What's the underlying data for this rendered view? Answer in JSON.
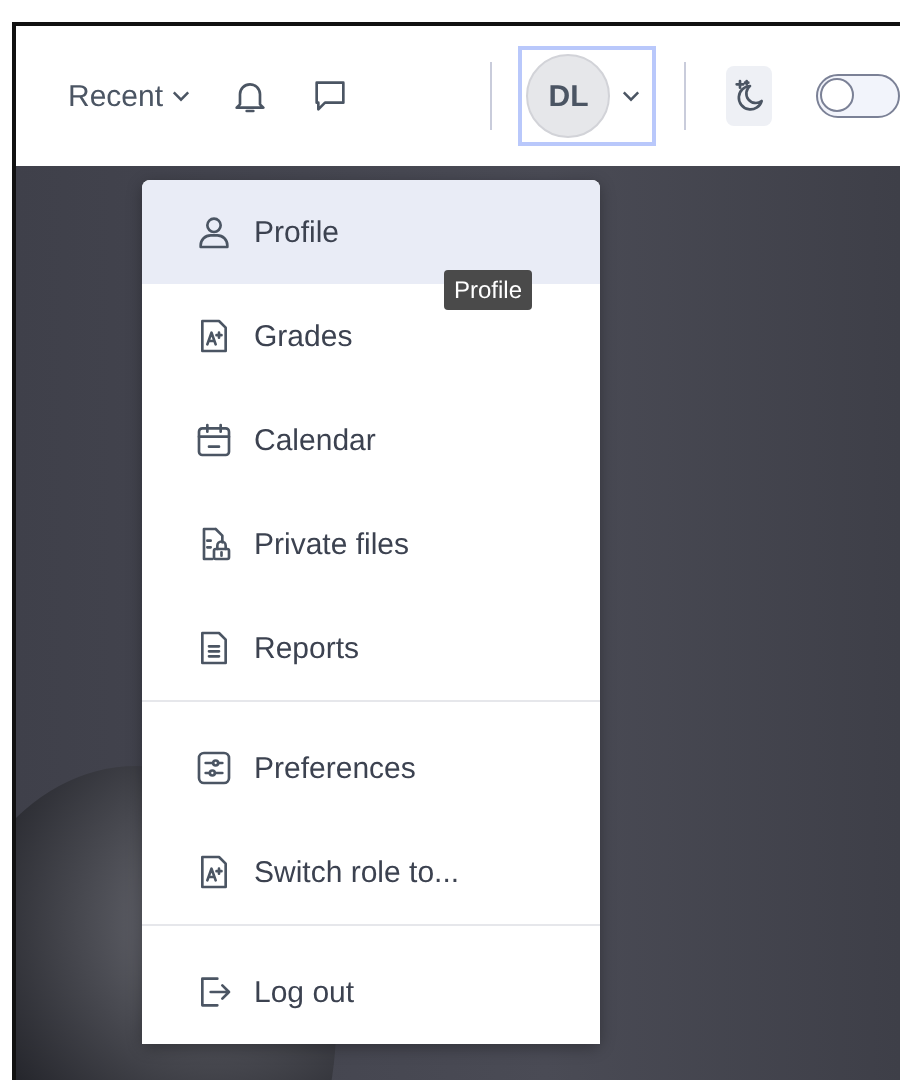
{
  "header": {
    "recent": {
      "label": "Recent"
    },
    "avatar": {
      "initials": "DL"
    },
    "dark_mode_toggle": {
      "on": false
    }
  },
  "user_menu": {
    "groups": [
      [
        {
          "label": "Profile",
          "kind": "person",
          "selected": true
        },
        {
          "label": "Grades",
          "kind": "grade",
          "selected": false
        },
        {
          "label": "Calendar",
          "kind": "calendar",
          "selected": false
        },
        {
          "label": "Private files",
          "kind": "files",
          "selected": false
        },
        {
          "label": "Reports",
          "kind": "report",
          "selected": false
        }
      ],
      [
        {
          "label": "Preferences",
          "kind": "sliders",
          "selected": false
        },
        {
          "label": "Switch role to...",
          "kind": "grade",
          "selected": false
        }
      ],
      [
        {
          "label": "Log out",
          "kind": "logout",
          "selected": false
        }
      ]
    ]
  },
  "tooltip": {
    "text": "Profile"
  }
}
